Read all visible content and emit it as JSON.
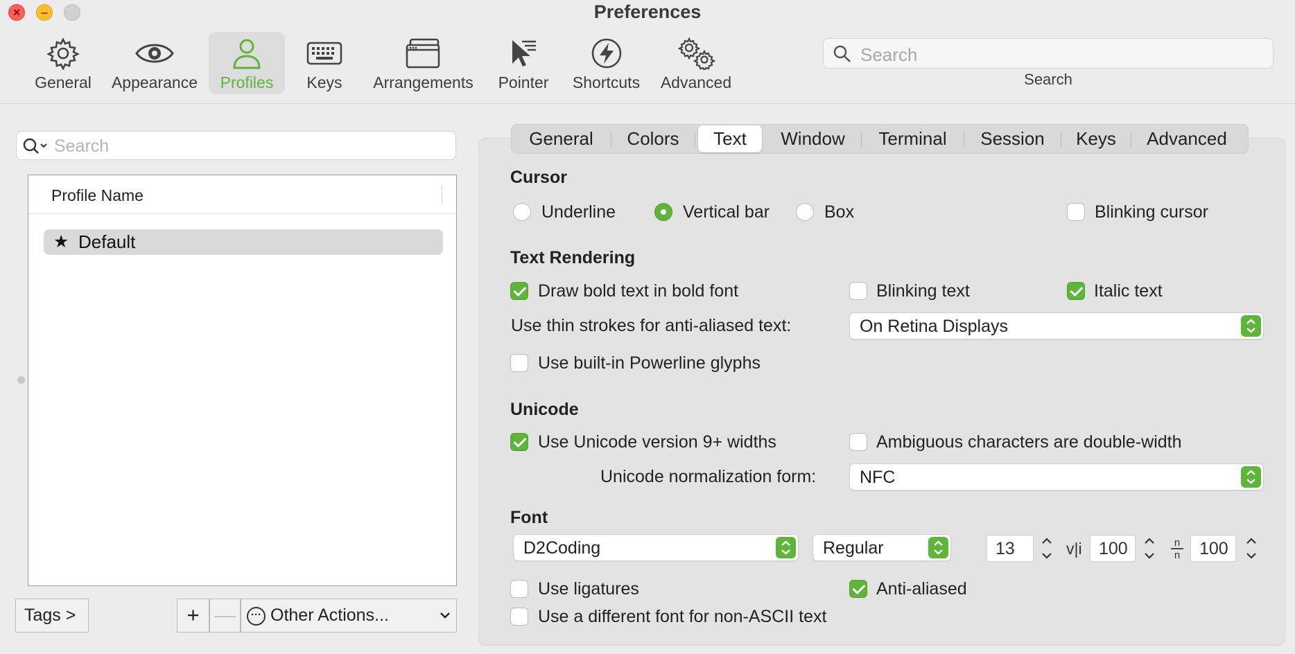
{
  "window": {
    "title": "Preferences"
  },
  "toolbar": {
    "items": [
      {
        "label": "General",
        "icon": "gear-icon"
      },
      {
        "label": "Appearance",
        "icon": "eye-icon"
      },
      {
        "label": "Profiles",
        "icon": "person-icon",
        "active": true
      },
      {
        "label": "Keys",
        "icon": "keyboard-icon"
      },
      {
        "label": "Arrangements",
        "icon": "window-stack-icon"
      },
      {
        "label": "Pointer",
        "icon": "pointer-icon"
      },
      {
        "label": "Shortcuts",
        "icon": "bolt-icon"
      },
      {
        "label": "Advanced",
        "icon": "gears-icon"
      }
    ],
    "search": {
      "placeholder": "Search",
      "label": "Search"
    }
  },
  "profiles": {
    "search_placeholder": "Search",
    "column_header": "Profile Name",
    "items": [
      {
        "name": "Default",
        "is_default": true
      }
    ],
    "tags_button": "Tags >",
    "add_button": "+",
    "remove_button": "—",
    "other_actions": "Other Actions..."
  },
  "tabs": [
    "General",
    "Colors",
    "Text",
    "Window",
    "Terminal",
    "Session",
    "Keys",
    "Advanced"
  ],
  "active_tab": "Text",
  "cursor": {
    "heading": "Cursor",
    "options": [
      "Underline",
      "Vertical bar",
      "Box"
    ],
    "selected": "Vertical bar",
    "blinking_label": "Blinking cursor",
    "blinking": false
  },
  "text_rendering": {
    "heading": "Text Rendering",
    "bold_label": "Draw bold text in bold font",
    "bold": true,
    "blinking_label": "Blinking text",
    "blinking": false,
    "italic_label": "Italic text",
    "italic": true,
    "thin_strokes_label": "Use thin strokes for anti-aliased text:",
    "thin_strokes_value": "On Retina Displays",
    "powerline_label": "Use built-in Powerline glyphs",
    "powerline": false
  },
  "unicode": {
    "heading": "Unicode",
    "widths_label": "Use Unicode version 9+ widths",
    "widths": true,
    "ambiguous_label": "Ambiguous characters are double-width",
    "ambiguous": false,
    "normalization_label": "Unicode normalization form:",
    "normalization_value": "NFC"
  },
  "font": {
    "heading": "Font",
    "family": "D2Coding",
    "style": "Regular",
    "size": "13",
    "hspacing_icon": "v|i",
    "hspacing": "100",
    "vspacing_icon": "n/n",
    "vspacing": "100",
    "ligatures_label": "Use ligatures",
    "ligatures": false,
    "antialiased_label": "Anti-aliased",
    "antialiased": true,
    "nonascii_label": "Use a different font for non-ASCII text",
    "nonascii": false
  },
  "colors": {
    "accent": "#5fb53a"
  }
}
